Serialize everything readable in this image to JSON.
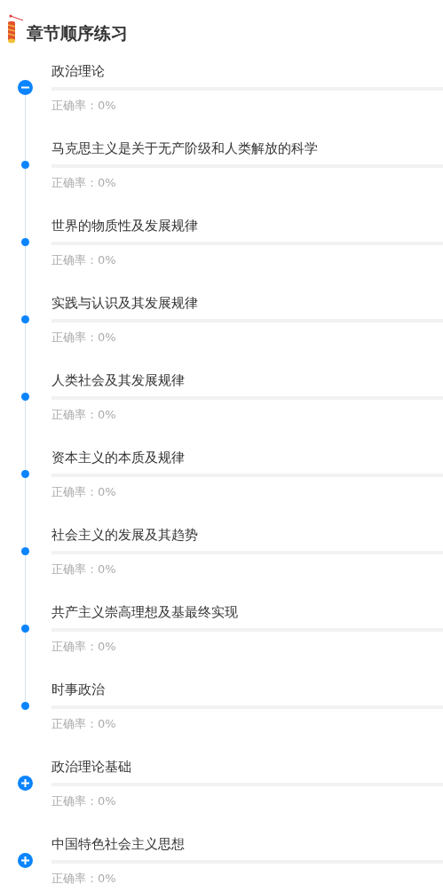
{
  "header": {
    "title": "章节顺序练习"
  },
  "sections": [
    {
      "title": "政治理论",
      "accuracy": "正确率：0%",
      "level": 0,
      "expanded": true,
      "children": [
        {
          "title": "马克思主义是关于无产阶级和人类解放的科学",
          "accuracy": "正确率：0%",
          "level": 0
        },
        {
          "title": "世界的物质性及发展规律",
          "accuracy": "正确率：0%",
          "level": 0
        },
        {
          "title": "实践与认识及其发展规律",
          "accuracy": "正确率：0%",
          "level": 0
        },
        {
          "title": "人类社会及其发展规律",
          "accuracy": "正确率：0%",
          "level": 0
        },
        {
          "title": "资本主义的本质及规律",
          "accuracy": "正确率：0%",
          "level": 0
        },
        {
          "title": "社会主义的发展及其趋势",
          "accuracy": "正确率：0%",
          "level": 0
        },
        {
          "title": "共产主义崇高理想及基最终实现",
          "accuracy": "正确率：0%",
          "level": 0
        },
        {
          "title": "时事政治",
          "accuracy": "正确率：0%",
          "level": 0
        }
      ]
    },
    {
      "title": "政治理论基础",
      "accuracy": "正确率：0%",
      "level": 0,
      "expanded": false
    },
    {
      "title": "中国特色社会主义思想",
      "accuracy": "正确率：0%",
      "level": 0,
      "expanded": false
    }
  ]
}
